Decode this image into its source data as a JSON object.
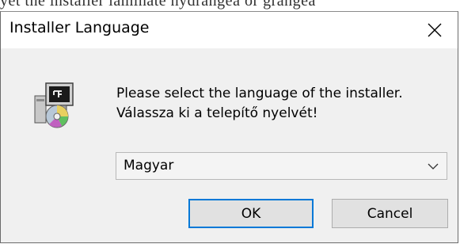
{
  "background_text": "yet the installer laminate hydrangea or grangea",
  "window": {
    "title": "Installer Language",
    "close_icon": "close-icon"
  },
  "dialog": {
    "icon": "installer-cd-icon",
    "prompt_line1": "Please select the language of the installer.",
    "prompt_line2": "Válassza ki a telepítő nyelvét!",
    "language_select": {
      "selected": "Magyar"
    },
    "ok_label": "OK",
    "cancel_label": "Cancel"
  },
  "colors": {
    "accent_focus": "#0078d7",
    "dialog_bg": "#f0f0f0",
    "button_bg": "#e1e1e1"
  }
}
